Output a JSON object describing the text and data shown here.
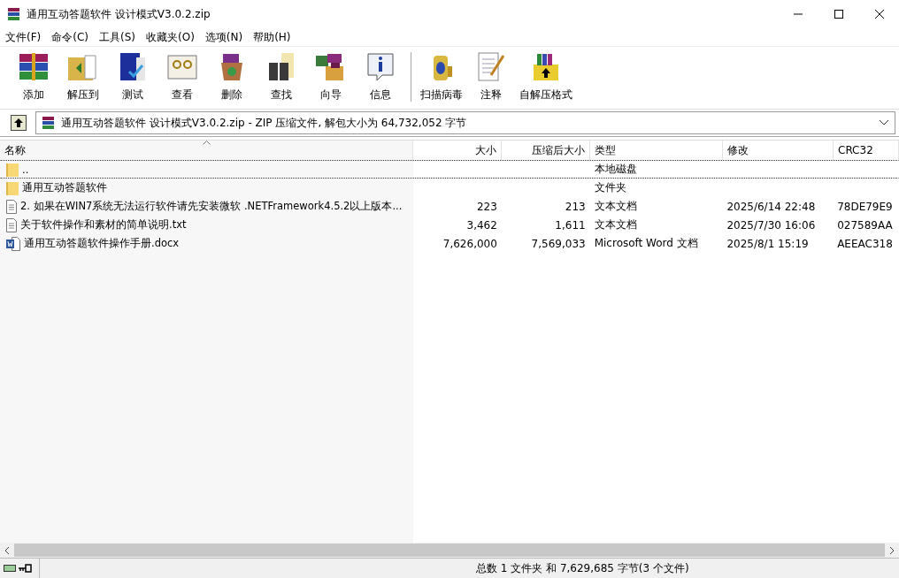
{
  "window": {
    "title": "通用互动答题软件 设计模式V3.0.2.zip"
  },
  "menu": [
    "文件(F)",
    "命令(C)",
    "工具(S)",
    "收藏夹(O)",
    "选项(N)",
    "帮助(H)"
  ],
  "toolbar": [
    {
      "label": "添加"
    },
    {
      "label": "解压到"
    },
    {
      "label": "测试"
    },
    {
      "label": "查看"
    },
    {
      "label": "删除"
    },
    {
      "label": "查找"
    },
    {
      "label": "向导"
    },
    {
      "label": "信息"
    },
    {
      "label": "扫描病毒"
    },
    {
      "label": "注释"
    },
    {
      "label": "自解压格式"
    }
  ],
  "address": {
    "value": "通用互动答题软件 设计模式V3.0.2.zip - ZIP 压缩文件, 解包大小为 64,732,052 字节"
  },
  "table": {
    "columns": [
      {
        "label": "名称",
        "sorted": true
      },
      {
        "label": "大小",
        "sorted": false
      },
      {
        "label": "压缩后大小",
        "sorted": false
      },
      {
        "label": "类型",
        "sorted": false
      },
      {
        "label": "修改",
        "sorted": false
      },
      {
        "label": "CRC32",
        "sorted": false
      }
    ],
    "rows": [
      {
        "kind": "folder",
        "focused": true,
        "cells": [
          "..",
          "",
          "",
          "本地磁盘",
          "",
          ""
        ]
      },
      {
        "kind": "folder",
        "focused": false,
        "cells": [
          "通用互动答题软件",
          "",
          "",
          "文件夹",
          "",
          ""
        ]
      },
      {
        "kind": "text",
        "focused": false,
        "cells": [
          "2. 如果在WIN7系统无法运行软件请先安装微软 .NETFramework4.5.2以上版本...",
          "223",
          "213",
          "文本文档",
          "2025/6/14 22:48",
          "78DE79E9"
        ]
      },
      {
        "kind": "text",
        "focused": false,
        "cells": [
          "关于软件操作和素材的简单说明.txt",
          "3,462",
          "1,611",
          "文本文档",
          "2025/7/30 16:06",
          "027589AA"
        ]
      },
      {
        "kind": "word",
        "focused": false,
        "cells": [
          "通用互动答题软件操作手册.docx",
          "7,626,000",
          "7,569,033",
          "Microsoft Word 文档",
          "2025/8/1 15:19",
          "AEEAC318"
        ]
      }
    ]
  },
  "status_bar": {
    "text": "总数 1 文件夹 和 7,629,685 字节(3 个文件)"
  }
}
